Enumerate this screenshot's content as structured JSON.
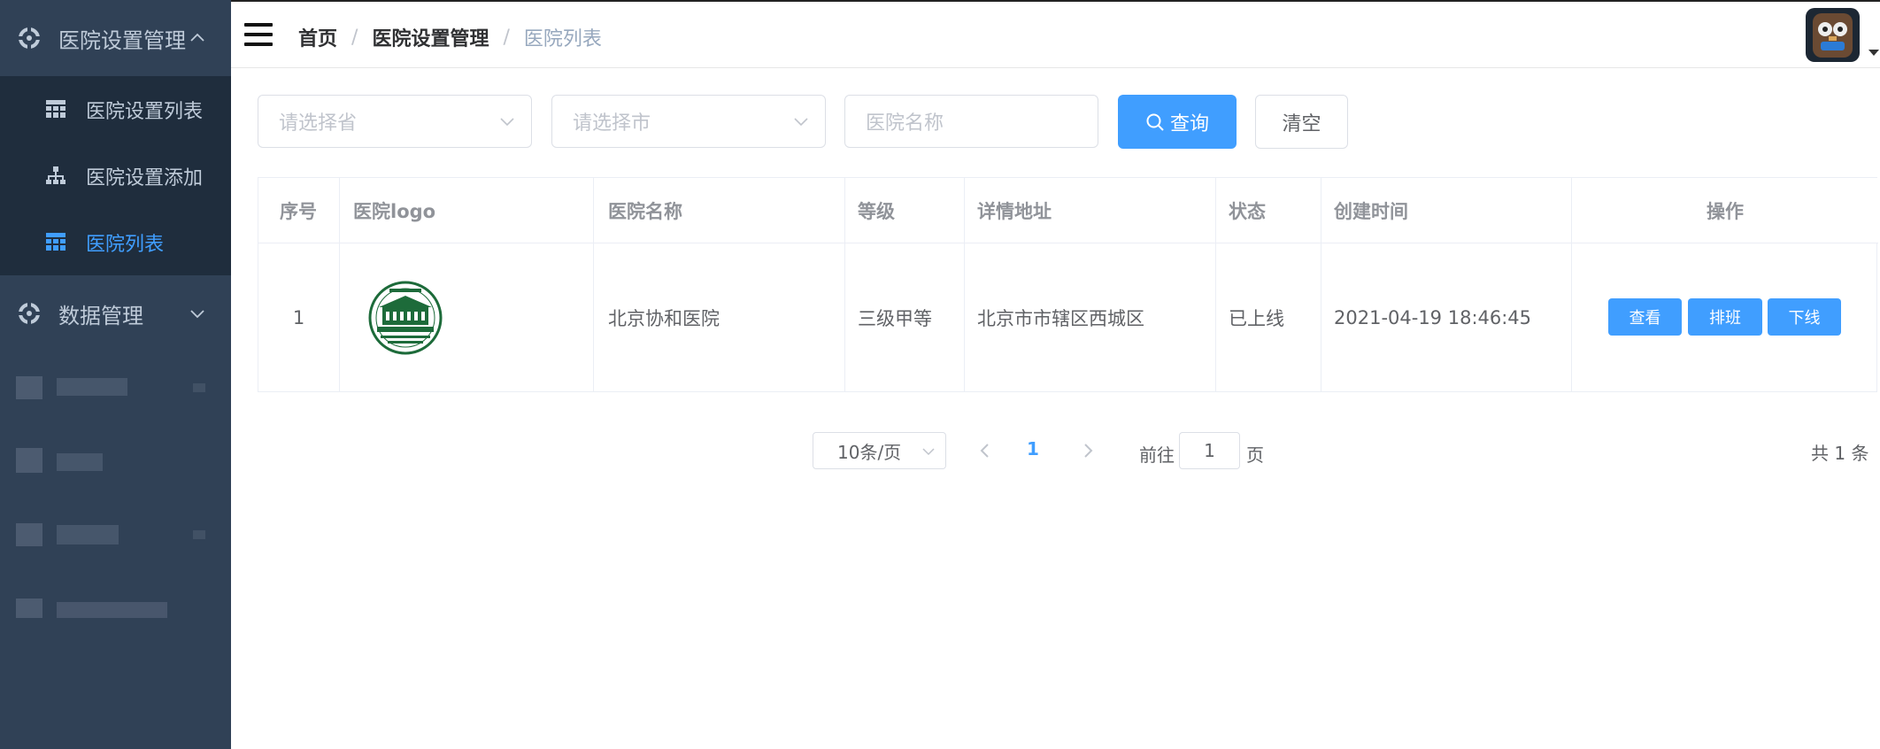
{
  "sidebar": {
    "groups": [
      {
        "label": "医院设置管理",
        "icon": "setting-icon",
        "expanded": true
      },
      {
        "label": "数据管理",
        "icon": "setting-icon",
        "expanded": false
      }
    ],
    "items": [
      {
        "label": "医院设置列表",
        "icon": "table-icon",
        "active": false
      },
      {
        "label": "医院设置添加",
        "icon": "tree-icon",
        "active": false
      },
      {
        "label": "医院列表",
        "icon": "table-icon",
        "active": true
      }
    ]
  },
  "header": {
    "breadcrumb": [
      "首页",
      "医院设置管理",
      "医院列表"
    ],
    "separator": "/"
  },
  "search": {
    "province_placeholder": "请选择省",
    "city_placeholder": "请选择市",
    "name_placeholder": "医院名称",
    "query_label": "查询",
    "clear_label": "清空"
  },
  "table": {
    "columns": [
      "序号",
      "医院logo",
      "医院名称",
      "等级",
      "详情地址",
      "状态",
      "创建时间",
      "操作"
    ],
    "rows": [
      {
        "index": "1",
        "name": "北京协和医院",
        "level": "三级甲等",
        "address": "北京市市辖区西城区",
        "status": "已上线",
        "created": "2021-04-19 18:46:45",
        "actions": [
          "查看",
          "排班",
          "下线"
        ]
      }
    ]
  },
  "pagination": {
    "page_size": "10条/页",
    "current_page": "1",
    "goto_label": "前往",
    "goto_value": "1",
    "page_unit": "页",
    "total": "共 1 条"
  },
  "colors": {
    "sidebar_bg": "#304156",
    "submenu_bg": "#1f2d3d",
    "accent": "#409eff",
    "logo_green": "#1d6b3a"
  }
}
